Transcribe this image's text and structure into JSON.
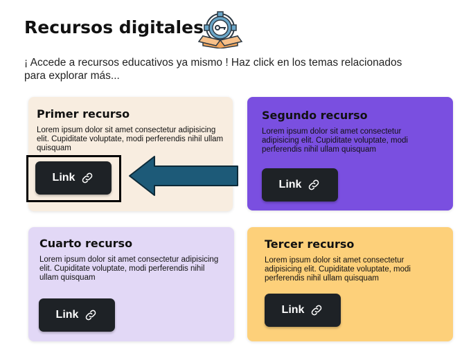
{
  "header": {
    "title": "Recursos digitales",
    "intro": "¡ Accede a recursos educativos ya mismo ! Haz click en los temas relacionados para explorar más..."
  },
  "cards": [
    {
      "title": "Primer recurso",
      "description": "Lorem ipsum dolor sit amet consectetur adipisicing elit. Cupiditate voluptate, modi perferendis nihil ullam quisquam",
      "button_label": "Link",
      "bg_color": "#f8ede0"
    },
    {
      "title": "Segundo recurso",
      "description": "Lorem ipsum dolor sit amet consectetur adipisicing elit. Cupiditate voluptate, modi perferendis nihil ullam quisquam",
      "button_label": "Link",
      "bg_color": "#7a4fe0"
    },
    {
      "title": "Cuarto recurso",
      "description": "Lorem ipsum dolor sit amet consectetur adipisicing elit. Cupiditate voluptate, modi perferendis nihil ullam quisquam",
      "button_label": "Link",
      "bg_color": "#e2d8f6"
    },
    {
      "title": "Tercer recurso",
      "description": "Lorem ipsum dolor sit amet consectetur adipisicing elit. Cupiditate voluptate, modi perferendis nihil ullam quisquam",
      "button_label": "Link",
      "bg_color": "#fdd07a"
    }
  ],
  "icons": {
    "title_icon": "gear-key-box-icon",
    "button_icon": "link-chain-icon",
    "annotation": "arrow-left-icon"
  },
  "colors": {
    "button_bg": "#1e2226",
    "arrow": "#1d5a78"
  }
}
